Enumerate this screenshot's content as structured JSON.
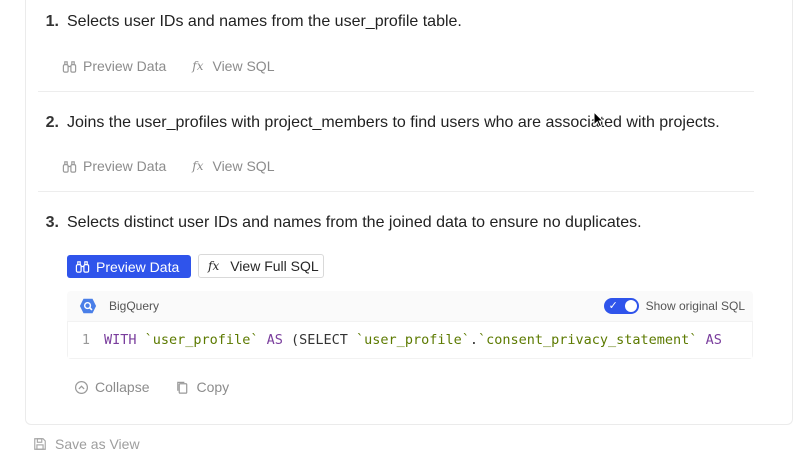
{
  "steps": [
    {
      "number": "1.",
      "text": "Selects user IDs and names from the user_profile table.",
      "preview_label": "Preview Data",
      "sql_label": "View SQL"
    },
    {
      "number": "2.",
      "text": "Joins the user_profiles with project_members to find users who are associated with projects.",
      "preview_label": "Preview Data",
      "sql_label": "View SQL"
    },
    {
      "number": "3.",
      "text": "Selects distinct user IDs and names from the joined data to ensure no duplicates.",
      "preview_label": "Preview Data",
      "sql_label": "View Full SQL"
    }
  ],
  "fx_glyph": "fx",
  "sql_panel": {
    "engine": "BigQuery",
    "toggle_label": "Show original SQL",
    "toggle_on": true,
    "line_number": "1",
    "code": {
      "t1": "WITH",
      "t2": "`user_profile`",
      "t3": "AS",
      "t4": "(SELECT",
      "t5": "`user_profile`",
      "t6": ".",
      "t7": "`consent_privacy_statement`",
      "t8": "AS"
    },
    "collapse_label": "Collapse",
    "copy_label": "Copy"
  },
  "footer": {
    "save_view_label": "Save as View"
  },
  "colors": {
    "primary": "#2f54eb",
    "muted": "#8c8c8c",
    "keyword": "#7a3e9d",
    "string": "#5c7a00"
  }
}
